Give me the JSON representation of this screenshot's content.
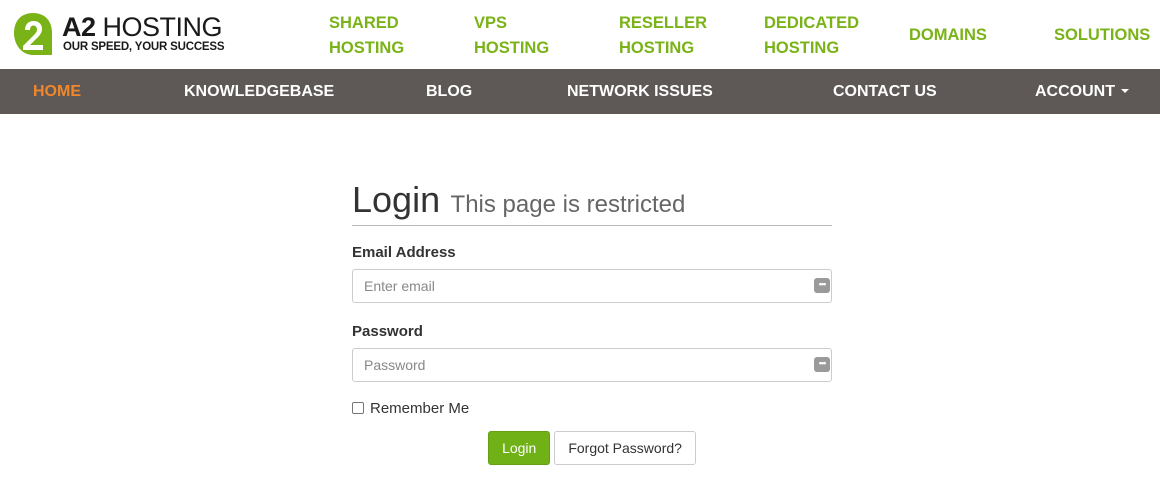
{
  "brand": {
    "name_bold": "A2",
    "name_light": "HOSTING",
    "tagline": "OUR SPEED, YOUR SUCCESS",
    "color": "#7ab317"
  },
  "top_nav": [
    {
      "line1": "SHARED",
      "line2": "HOSTING"
    },
    {
      "line1": "VPS",
      "line2": "HOSTING"
    },
    {
      "line1": "RESELLER",
      "line2": "HOSTING"
    },
    {
      "line1": "DEDICATED",
      "line2": "HOSTING"
    },
    {
      "line1": "DOMAINS"
    },
    {
      "line1": "SOLUTIONS"
    }
  ],
  "main_nav": {
    "items": [
      "HOME",
      "KNOWLEDGEBASE",
      "BLOG",
      "NETWORK ISSUES",
      "CONTACT US"
    ],
    "account_label": "ACCOUNT",
    "active_item": "HOME",
    "bar_color": "#5e5956",
    "active_color": "#f2862b"
  },
  "login": {
    "title": "Login",
    "subtitle": "This page is restricted",
    "email_label": "Email Address",
    "email_placeholder": "Enter email",
    "email_value": "",
    "password_label": "Password",
    "password_placeholder": "Password",
    "password_value": "",
    "remember_label": "Remember Me",
    "remember_checked": false,
    "login_button": "Login",
    "forgot_button": "Forgot Password?",
    "button_color": "#6fb116"
  },
  "icons": {
    "input_autofill": "dots-icon"
  }
}
